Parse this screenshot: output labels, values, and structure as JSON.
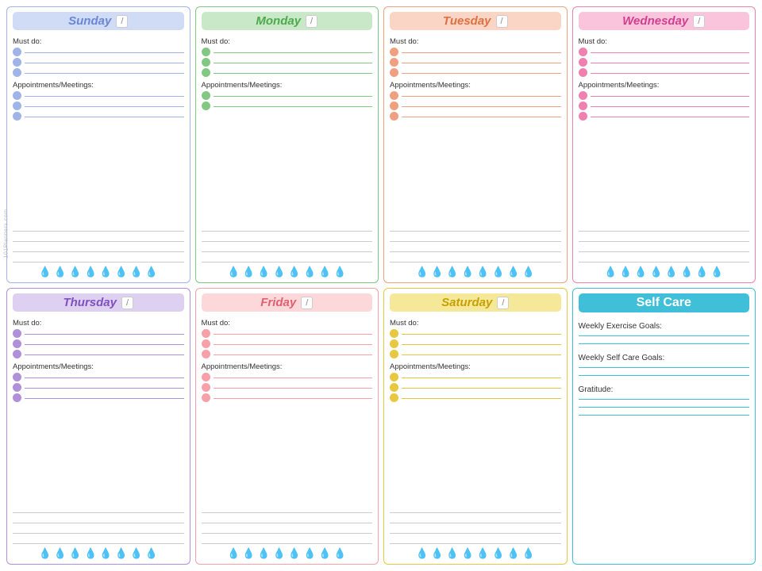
{
  "watermark": "101Planners.com",
  "days": [
    {
      "id": "sunday",
      "title": "Sunday",
      "dateSlash": "/",
      "mustDoLabel": "Must do:",
      "apptLabel": "Appointments/Meetings:",
      "bulletCount": 3,
      "apptCount": 3,
      "noteLines": 4,
      "waterDrops": 8
    },
    {
      "id": "monday",
      "title": "Monday",
      "dateSlash": "/",
      "mustDoLabel": "Must do:",
      "apptLabel": "Appointments/Meetings:",
      "bulletCount": 3,
      "apptCount": 2,
      "noteLines": 4,
      "waterDrops": 8
    },
    {
      "id": "tuesday",
      "title": "Tuesday",
      "dateSlash": "/",
      "mustDoLabel": "Must do:",
      "apptLabel": "Appointments/Meetings:",
      "bulletCount": 3,
      "apptCount": 3,
      "noteLines": 4,
      "waterDrops": 8
    },
    {
      "id": "wednesday",
      "title": "Wednesday",
      "dateSlash": "/",
      "mustDoLabel": "Must do:",
      "apptLabel": "Appointments/Meetings:",
      "bulletCount": 3,
      "apptCount": 3,
      "noteLines": 4,
      "waterDrops": 8
    },
    {
      "id": "thursday",
      "title": "Thursday",
      "dateSlash": "/",
      "mustDoLabel": "Must do:",
      "apptLabel": "Appointments/Meetings:",
      "bulletCount": 3,
      "apptCount": 3,
      "noteLines": 4,
      "waterDrops": 8
    },
    {
      "id": "friday",
      "title": "Friday",
      "dateSlash": "/",
      "mustDoLabel": "Must do:",
      "apptLabel": "Appointments/Meetings:",
      "bulletCount": 3,
      "apptCount": 3,
      "noteLines": 4,
      "waterDrops": 8
    },
    {
      "id": "saturday",
      "title": "Saturday",
      "dateSlash": "/",
      "mustDoLabel": "Must do:",
      "apptLabel": "Appointments/Meetings:",
      "bulletCount": 3,
      "apptCount": 3,
      "noteLines": 4,
      "waterDrops": 8
    }
  ],
  "selfCare": {
    "title": "Self Care",
    "sections": [
      {
        "label": "Weekly Exercise Goals:",
        "lines": 2
      },
      {
        "label": "Weekly Self Care Goals:",
        "lines": 2
      },
      {
        "label": "Gratitude:",
        "lines": 3
      }
    ]
  }
}
